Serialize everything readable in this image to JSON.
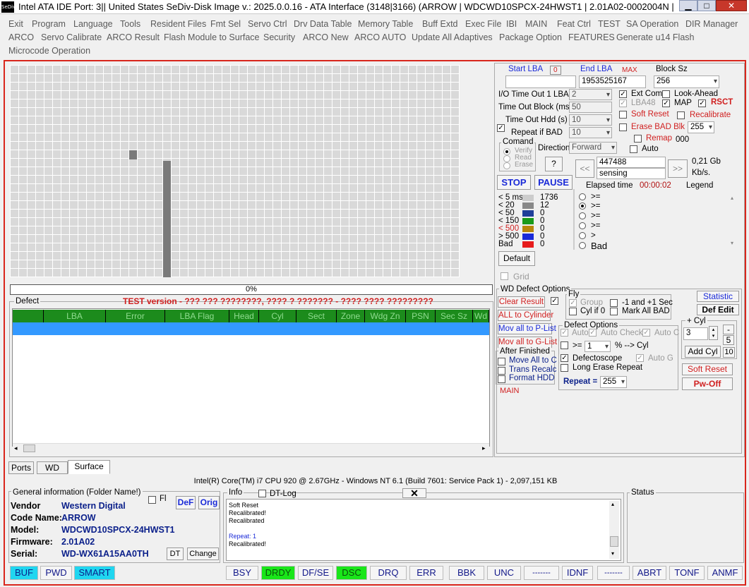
{
  "window": {
    "title": "Intel ATA IDE  Port: 3|| United States  SeDiv-Disk Image v.: 2025.0.0.16 - ATA Interface (3148|3166)  (ARROW | WDCWD10SPCX-24HWST1 | 2.01A02-0002004N | WD-WX61A1...",
    "icon_text": "SeDiv",
    "min": "▁",
    "max": "□",
    "close": "✕"
  },
  "menu": {
    "row1": [
      "Exit",
      "Program",
      "Language",
      "Tools",
      "Resident Files",
      "Fmt Sel",
      "Servo Ctrl",
      "Drv Data Table",
      "Memory Table",
      "Buff Extd",
      "Exec File",
      "IBI",
      "MAIN",
      "Feat Ctrl",
      "TEST",
      "SA Operation",
      "DIR Manager"
    ],
    "row2": [
      "ARCO",
      "Servo Calibrate",
      "ARCO Result",
      "Flash Module to Surface",
      "Security",
      "ARCO New",
      "ARCO AUTO",
      "Update All Adaptives",
      "Package Option",
      "FEATURES",
      "Generate u14 Flash"
    ],
    "row3": [
      "Microcode Operation"
    ]
  },
  "progress": "0%",
  "defect": {
    "label": "Defect",
    "warning": "TEST version - ??? ??? ????????, ???? ? ??????? - ???? ???? ?????????",
    "columns": [
      "",
      "LBA",
      "Error",
      "LBA Flag",
      "Head",
      "Cyl",
      "Sect",
      "Zone",
      "Wdg Zn",
      "PSN",
      "Sec Sz",
      "Wd"
    ]
  },
  "scan": {
    "start_lba_label": "Start LBA",
    "start_lba_zero": "0",
    "end_lba_label": "End LBA",
    "max_label": "MAX",
    "block_sz_label": "Block Sz",
    "start_lba": "",
    "end_lba": "1953525167",
    "block_sz": "256",
    "io_timeout_label": "I/O Time Out 1 LBA",
    "io_timeout": "2",
    "timeout_block_label": "Time Out Block (ms)",
    "timeout_block": "50",
    "timeout_hdd_label": "Time Out Hdd (s)",
    "timeout_hdd": "10",
    "repeat_bad_label": "Repeat if BAD",
    "repeat_bad": "10",
    "ext_com": "Ext Com",
    "look_ahead": "Look-Ahead",
    "lba48": "LBA48",
    "map": "MAP",
    "rsct": "RSCT",
    "soft_reset": "Soft Reset",
    "recalibrate": "Recalibrate",
    "erase_bad": "Erase BAD Blk",
    "erase_val": "255",
    "remap": "Remap",
    "remap_val": "000",
    "auto": "Auto",
    "command_label": "Comand",
    "verify": "Verify",
    "read": "Read",
    "erase": "Erase",
    "direction_label": "Direction",
    "direction": "Forward",
    "q": "?",
    "current": "447488",
    "sensing": "sensing",
    "prev": "<<",
    "next": ">>",
    "speed": "0,21 Gb",
    "speed_unit": "Kb/s.",
    "elapsed_label": "Elapsed time",
    "elapsed": "00:00:02",
    "legend_label": "Legend",
    "stop": "STOP",
    "pause": "PAUSE"
  },
  "legend": [
    {
      "label": "< 5 ms",
      "count": "1736",
      "color": "#cccccc"
    },
    {
      "label": "< 20",
      "count": "12",
      "color": "#888888"
    },
    {
      "label": "< 50",
      "count": "0",
      "color": "#1f3f99"
    },
    {
      "label": "< 150",
      "count": "0",
      "color": "#1a9a1a"
    },
    {
      "label": "< 500",
      "count": "0",
      "color": "#b8860b"
    },
    {
      "label": "> 500",
      "count": "0",
      "color": "#1a2ad8"
    },
    {
      "label": "Bad",
      "count": "0",
      "color": "#e61b1b"
    }
  ],
  "ops": [
    ">=",
    ">=",
    ">=",
    ">=",
    ">",
    "Bad"
  ],
  "default_btn": "Default",
  "grid_label": "Grid",
  "wd": {
    "label": "WD Defect Options",
    "clear_result": "Clear Result",
    "all_to_cyl": "ALL to Cylinder",
    "p_list": "Mov all to P-List",
    "g_list": "Mov all to G-List",
    "fly": "Fly",
    "group": "Group",
    "cyl_if_0": "Cyl if 0",
    "plus_minus": "-1 and +1 Sec",
    "mark_all_bad": "Mark All BAD",
    "statistic": "Statistic",
    "def_edit": "Def Edit",
    "cyl_label": "+ Cyl",
    "cyl_val": "3",
    "cyl_5": "5",
    "add_cyl": "Add Cyl",
    "add_val": "10",
    "defect_options": "Defect Options",
    "auto": "Auto",
    "auto_check": "Auto Check",
    "auto_c": "Auto C",
    "ge": ">=",
    "ge_val": "1",
    "pct_cyl": "% --> Cyl",
    "defectoscope": "Defectoscope",
    "auto_g": "Auto G",
    "long_erase": "Long Erase Repeat",
    "repeat_label": "Repeat =",
    "repeat_val": "255",
    "after_finished": "After Finished",
    "move_all": "Move All to C",
    "trans": "Trans Recalc",
    "format": "Format HDD",
    "main": "MAIN",
    "soft_reset": "Soft Reset",
    "pw_off": "Pw-Off"
  },
  "tabs": [
    "Ports",
    "WD",
    "Surface"
  ],
  "cpu": "Intel(R) Core(TM) i7 CPU 920  @ 2.67GHz - Windows NT 6.1 (Build 7601: Service Pack 1) -  2,097,151 KB",
  "general": {
    "label": "General information (Folder Name!)",
    "fl": "Fl",
    "def": "DeF",
    "orig": "Orig",
    "vendor_label": "Vendor",
    "vendor": "Western Digital",
    "code_label": "Code Name:",
    "code": "ARROW",
    "model_label": "Model:",
    "model": "WDCWD10SPCX-24HWST1",
    "firmware_label": "Firmware:",
    "firmware": "2.01A02",
    "serial_label": "Serial:",
    "serial": "WD-WX61A15AA0TH",
    "dt": "DT",
    "change": "Change"
  },
  "info": {
    "label": "Info",
    "dtlog": "DT-Log",
    "close": "✕",
    "lines": [
      "Soft Reset",
      "Recalibrated!",
      "Recalibrated",
      "",
      "Repeat: 1",
      "Recalibrated!"
    ]
  },
  "status_label": "Status",
  "bottom": {
    "left": [
      "BUF",
      "PWD",
      "SMART"
    ],
    "flags": [
      "BSY",
      "DRDY",
      "DF/SE",
      "DSC",
      "DRQ",
      "ERR"
    ],
    "errs": [
      "BBK",
      "UNC",
      "-------",
      "IDNF",
      "-------",
      "ABRT",
      "TONF",
      "ANMF"
    ]
  }
}
